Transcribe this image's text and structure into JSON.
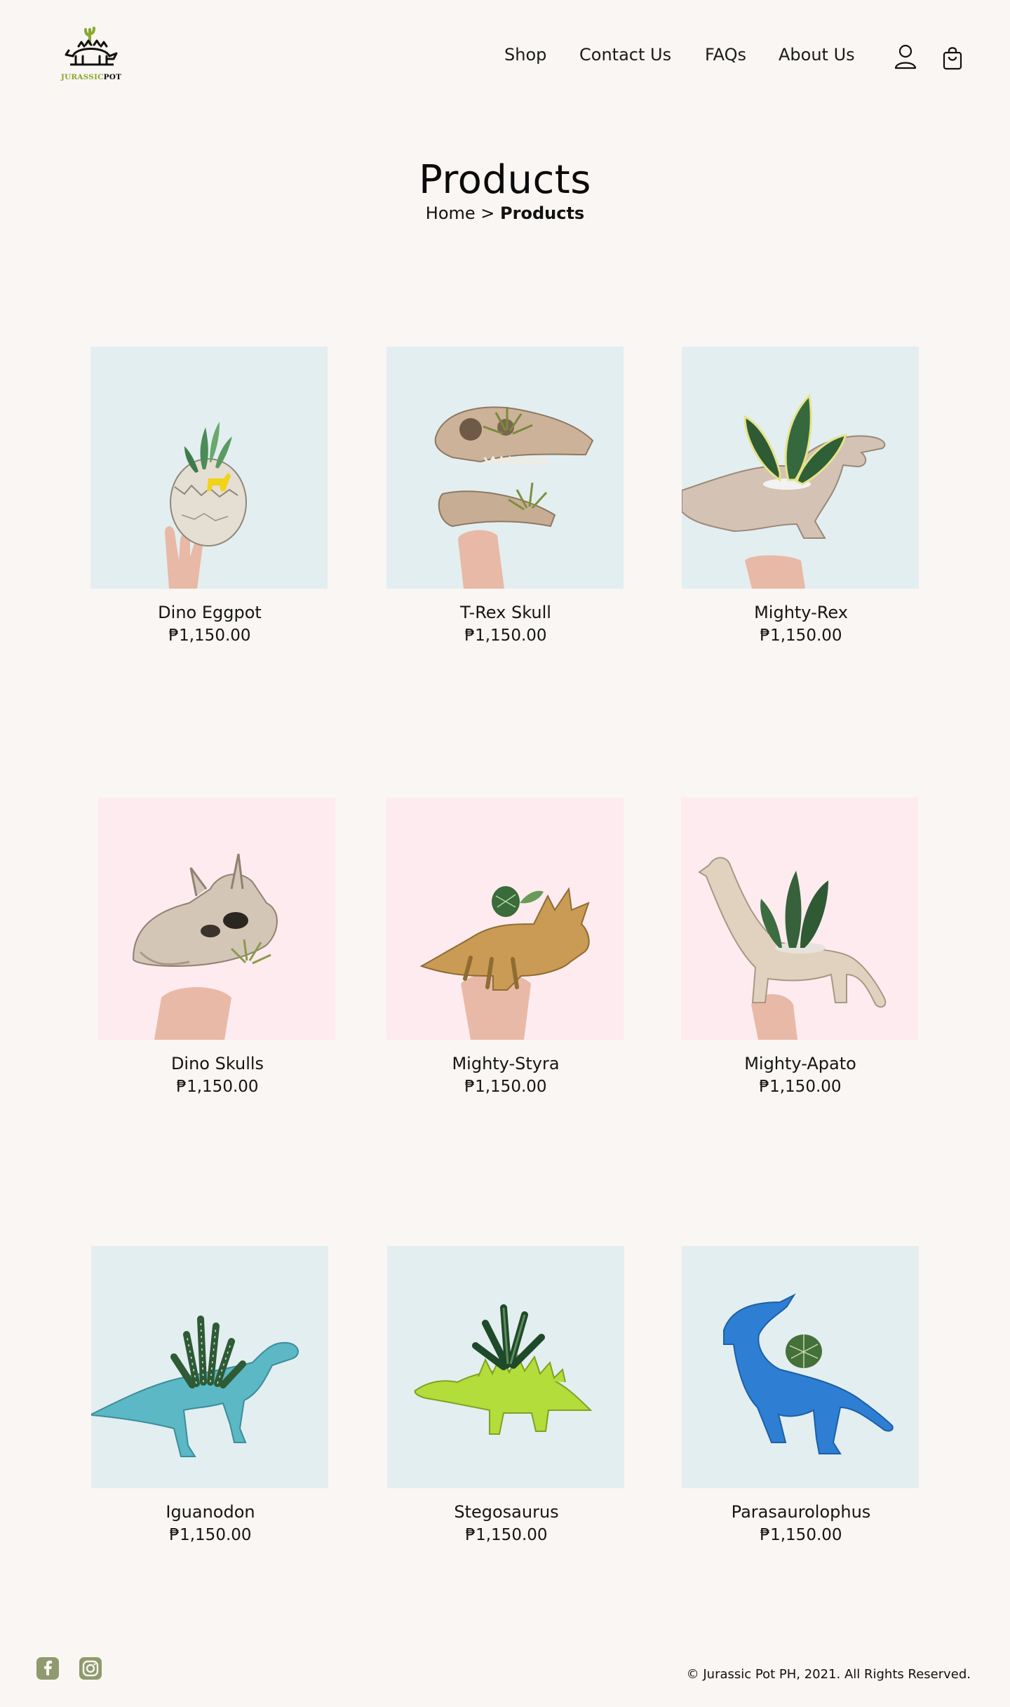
{
  "brand": {
    "logo_text_part1": "JURASSIC",
    "logo_text_part2": "POT",
    "accent": "#8aa82e"
  },
  "nav": {
    "items": [
      {
        "label": "Shop"
      },
      {
        "label": "Contact Us"
      },
      {
        "label": "FAQs"
      },
      {
        "label": "About Us"
      }
    ],
    "icons": [
      "user-icon",
      "shopping-bag-icon"
    ]
  },
  "header": {
    "title": "Products",
    "breadcrumb": {
      "home": "Home",
      "separator": ">",
      "current": "Products"
    }
  },
  "products": [
    {
      "name": "Dino Eggpot",
      "price": "₱1,150.00",
      "bg": "#e3eef0"
    },
    {
      "name": "T-Rex Skull",
      "price": "₱1,150.00",
      "bg": "#e3eef0"
    },
    {
      "name": "Mighty-Rex",
      "price": "₱1,150.00",
      "bg": "#e3eef0"
    },
    {
      "name": "Dino Skulls",
      "price": "₱1,150.00",
      "bg": "#fdebef"
    },
    {
      "name": "Mighty-Styra",
      "price": "₱1,150.00",
      "bg": "#fdebef"
    },
    {
      "name": "Mighty-Apato",
      "price": "₱1,150.00",
      "bg": "#fdebef"
    },
    {
      "name": "Iguanodon",
      "price": "₱1,150.00",
      "bg": "#e3eef0"
    },
    {
      "name": "Stegosaurus",
      "price": "₱1,150.00",
      "bg": "#e3eef0"
    },
    {
      "name": "Parasaurolophus",
      "price": "₱1,150.00",
      "bg": "#e3eef0"
    }
  ],
  "footer": {
    "social": [
      "facebook-icon",
      "instagram-icon"
    ],
    "social_color": "#8f9a6e",
    "copyright": "© Jurassic Pot PH, 2021. All Rights Reserved."
  }
}
